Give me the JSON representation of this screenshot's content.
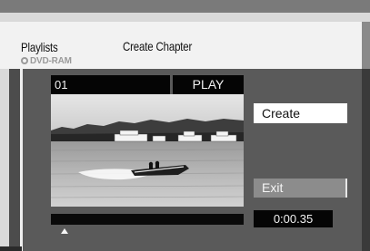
{
  "header": {
    "section_label": "Playlists",
    "screen_title": "Create Chapter",
    "disc_type": "DVD-RAM",
    "disc_icon": "disc-icon"
  },
  "player": {
    "track_number": "01",
    "state": "PLAY",
    "video_description_icon": "video-frame",
    "time": "0:00.35",
    "marker_position_fraction": 0.07
  },
  "actions": {
    "create_label": "Create",
    "exit_label": "Exit"
  },
  "colors": {
    "background": "#5a5a5a",
    "header": "#f2f2f2",
    "bar": "#050505",
    "button_highlight": "#ffffff",
    "button_normal": "#8c8c8c"
  }
}
